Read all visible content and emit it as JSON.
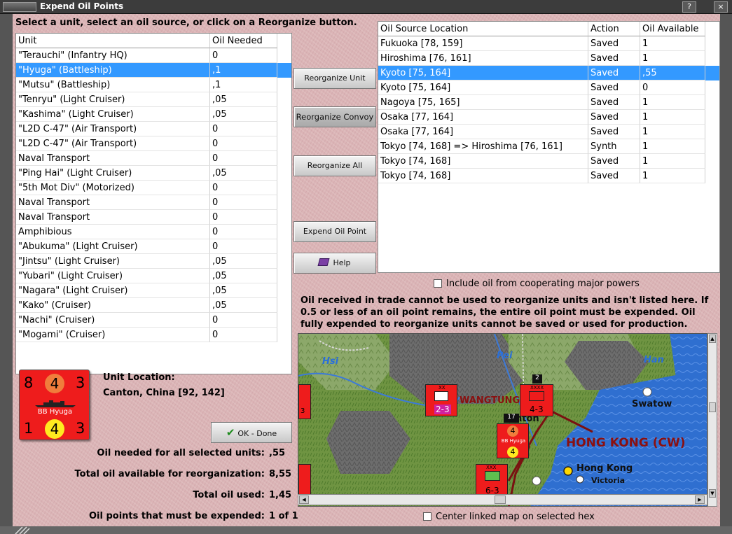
{
  "window": {
    "title": "Expend Oil Points",
    "instruction": "Select a unit, select an oil source, or click on a Reorganize button."
  },
  "units_table": {
    "headers": [
      "Unit",
      "Oil Needed"
    ],
    "rows": [
      {
        "unit": "\"Terauchi\" (Infantry HQ)",
        "oil": "0"
      },
      {
        "unit": "\"Hyuga\" (Battleship)",
        "oil": ",1"
      },
      {
        "unit": "\"Mutsu\" (Battleship)",
        "oil": ",1"
      },
      {
        "unit": "\"Tenryu\" (Light Cruiser)",
        "oil": ",05"
      },
      {
        "unit": "\"Kashima\" (Light Cruiser)",
        "oil": ",05"
      },
      {
        "unit": "\"L2D C-47\" (Air Transport)",
        "oil": "0"
      },
      {
        "unit": "\"L2D C-47\" (Air Transport)",
        "oil": "0"
      },
      {
        "unit": "Naval Transport",
        "oil": "0"
      },
      {
        "unit": "\"Ping Hai\" (Light Cruiser)",
        "oil": ",05"
      },
      {
        "unit": "\"5th Mot Div\" (Motorized)",
        "oil": "0"
      },
      {
        "unit": "Naval Transport",
        "oil": "0"
      },
      {
        "unit": "Naval Transport",
        "oil": "0"
      },
      {
        "unit": "Amphibious",
        "oil": "0"
      },
      {
        "unit": "\"Abukuma\" (Light Cruiser)",
        "oil": "0"
      },
      {
        "unit": "\"Jintsu\" (Light Cruiser)",
        "oil": ",05"
      },
      {
        "unit": "\"Yubari\" (Light Cruiser)",
        "oil": ",05"
      },
      {
        "unit": "\"Nagara\" (Light Cruiser)",
        "oil": ",05"
      },
      {
        "unit": "\"Kako\" (Cruiser)",
        "oil": ",05"
      },
      {
        "unit": "\"Nachi\" (Cruiser)",
        "oil": "0"
      },
      {
        "unit": "\"Mogami\" (Cruiser)",
        "oil": "0"
      }
    ]
  },
  "buttons": {
    "reorganize_unit": "Reorganize Unit",
    "reorganize_convoy": "Reorganize Convoy",
    "reorganize_all": "Reorganize All",
    "expend_oil_point": "Expend Oil Point",
    "help": "Help",
    "ok_done": "OK - Done"
  },
  "oil_table": {
    "headers": [
      "Oil Source Location",
      "Action",
      "Oil Available"
    ],
    "rows": [
      {
        "location": "Fukuoka [78, 159]",
        "action": "Saved",
        "avail": "1"
      },
      {
        "location": "Hiroshima [76, 161]",
        "action": "Saved",
        "avail": "1"
      },
      {
        "location": "Kyoto [75, 164]",
        "action": "Saved",
        "avail": ",55"
      },
      {
        "location": "Kyoto [75, 164]",
        "action": "Saved",
        "avail": "0"
      },
      {
        "location": "Nagoya [75, 165]",
        "action": "Saved",
        "avail": "1"
      },
      {
        "location": "Osaka [77, 164]",
        "action": "Saved",
        "avail": "1"
      },
      {
        "location": "Osaka [77, 164]",
        "action": "Saved",
        "avail": "1"
      },
      {
        "location": "Tokyo [74, 168] => Hiroshima [76, 161]",
        "action": "Synth",
        "avail": "1"
      },
      {
        "location": "Tokyo [74, 168]",
        "action": "Saved",
        "avail": "1"
      },
      {
        "location": "Tokyo [74, 168]",
        "action": "Saved",
        "avail": "1"
      }
    ]
  },
  "include_oil_label": "Include oil from cooperating major powers",
  "note": "Oil received in trade cannot be used to reorganize units and isn't listed here.  If 0.5 or less of an oil point remains, the entire oil point must be expended.   Oil fully expended to reorganize units cannot be saved or used for production.",
  "unit_counter": {
    "tl": "8",
    "tc": "4",
    "tr": "3",
    "name": "BB Hyuga",
    "bl": "1",
    "bc": "4",
    "br": "3"
  },
  "unit_location": {
    "label": "Unit Location:",
    "value": "Canton, China [92, 142]"
  },
  "summary": {
    "needed_label": "Oil needed for all selected units:",
    "needed_value": ",55",
    "available_label": "Total oil available for reorganization:",
    "available_value": "8,55",
    "used_label": "Total oil used:",
    "used_value": "1,45",
    "expended_label": "Oil points that must be expended:",
    "expended_value": "1 of 1"
  },
  "map": {
    "labels": {
      "river_hsi": "Hsi",
      "river_pei": "Pei",
      "river_han": "Han",
      "kwangtung": "WANGTUNG",
      "swatow": "Swatow",
      "canton": "nton",
      "hong_kong_region": "HONG KONG (CW)",
      "hong_kong_city": "Hong Kong",
      "victoria": "Victoria"
    },
    "counters": {
      "ic_left_top": "3",
      "hq_label": "XX",
      "hq_value": "2-3",
      "arm_label": "XXXX",
      "arm_value": "4-3",
      "arm_stack": "2",
      "hyuga_stack": "17",
      "hyuga_name": "BB Hyuga",
      "inf_label": "XXX",
      "inf_value": "6-3"
    }
  },
  "center_map_label": "Center linked map on selected hex",
  "colors": {
    "selection": "#3399ff",
    "counter_red": "#ee1c1c",
    "sea_blue": "#2f6fd0",
    "hk_text": "#8a1010"
  }
}
